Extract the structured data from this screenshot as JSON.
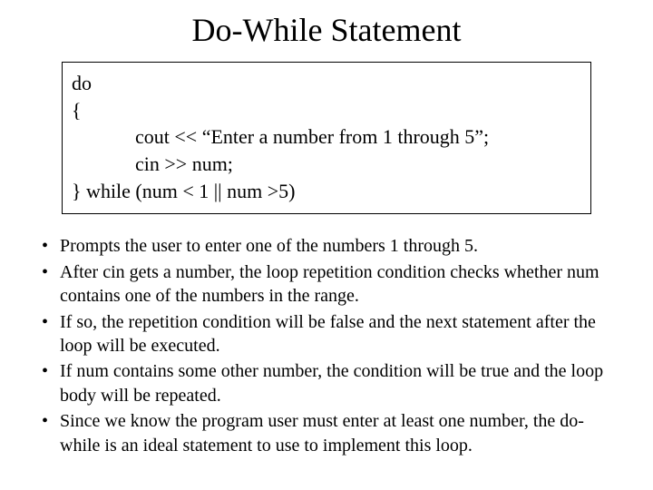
{
  "title": "Do-While Statement",
  "code": {
    "l1": "do",
    "l2": "{",
    "l3": "cout << “Enter a number from 1 through 5”;",
    "l4": "cin >> num;",
    "l5": "} while (num < 1 || num >5)"
  },
  "bullets": [
    " Prompts the user to enter one of the numbers 1 through 5.",
    "After cin gets a number, the loop repetition condition checks whether num contains one of the numbers in the range.",
    "If so, the repetition condition will be false and the next statement after the loop will be executed.",
    "If num contains some other number, the condition will be true and the loop body will be repeated.",
    "Since we know the program user must enter at least one number, the do-while is an ideal statement to use to implement this loop."
  ]
}
